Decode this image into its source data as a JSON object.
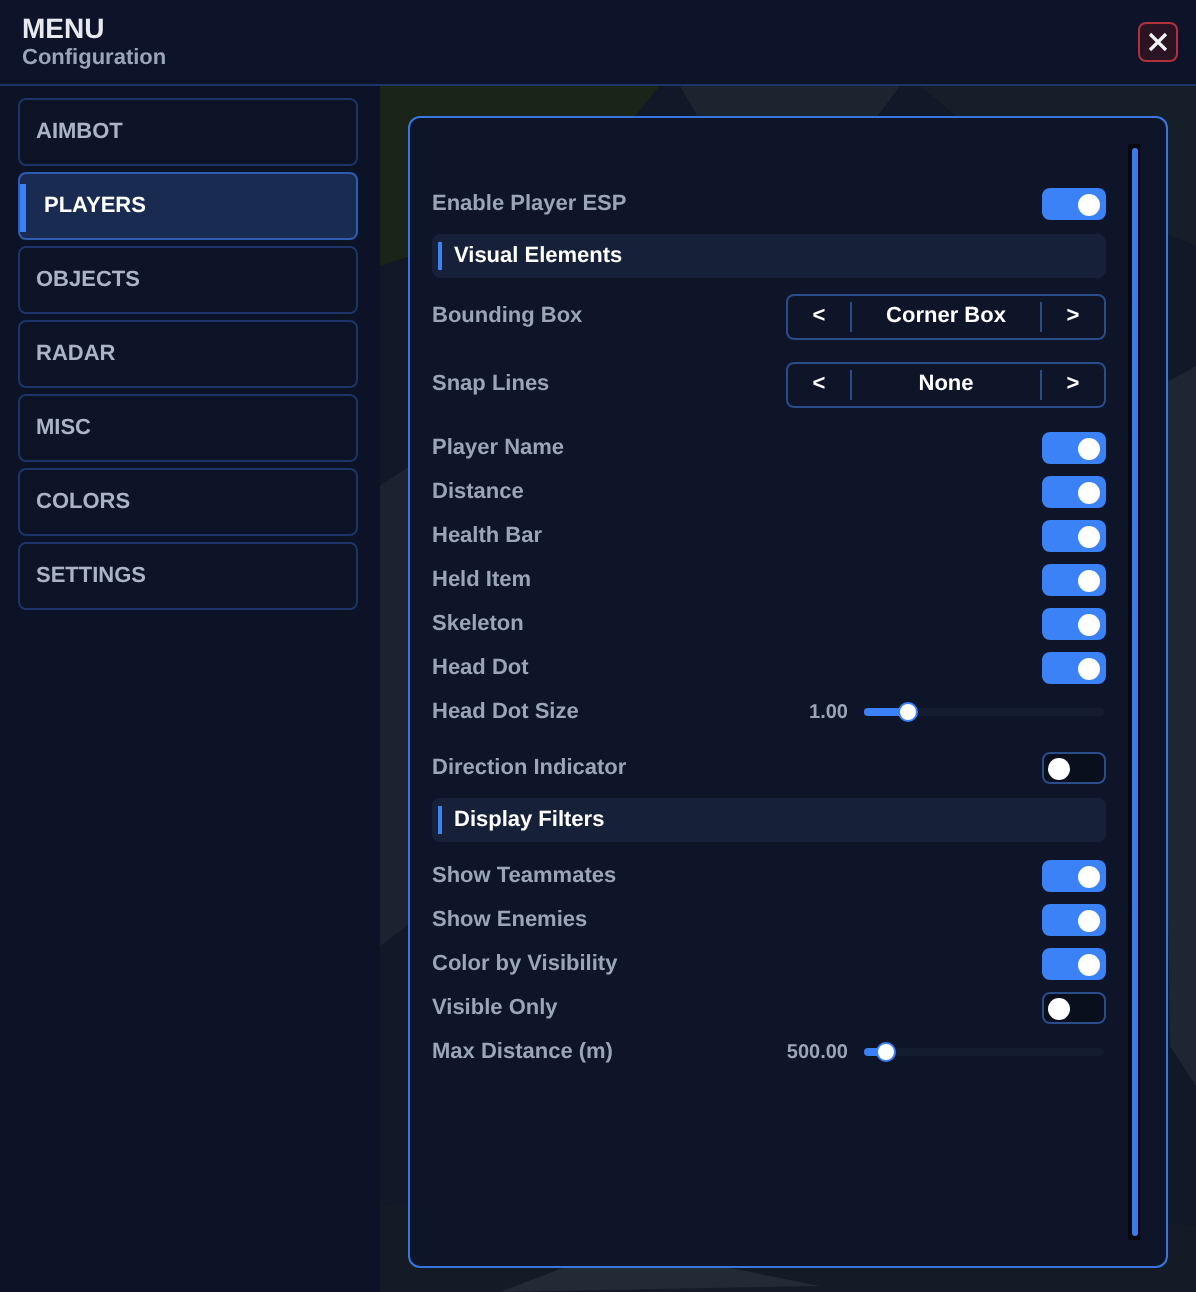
{
  "window": {
    "title": "MENU",
    "subtitle": "Configuration"
  },
  "sidebar": {
    "items": [
      {
        "label": "AIMBOT",
        "selected": false
      },
      {
        "label": "PLAYERS",
        "selected": true
      },
      {
        "label": "OBJECTS",
        "selected": false
      },
      {
        "label": "RADAR",
        "selected": false
      },
      {
        "label": "MISC",
        "selected": false
      },
      {
        "label": "COLORS",
        "selected": false
      },
      {
        "label": "SETTINGS",
        "selected": false
      }
    ]
  },
  "settings": [
    {
      "kind": "toggle",
      "label": "Enable Player ESP",
      "on": true
    },
    {
      "kind": "section",
      "label": "Visual Elements"
    },
    {
      "kind": "selector",
      "label": "Bounding Box",
      "prev": "<",
      "value": "Corner Box",
      "next": ">"
    },
    {
      "kind": "selector",
      "label": "Snap Lines",
      "prev": "<",
      "value": "None",
      "next": ">"
    },
    {
      "kind": "toggle",
      "label": "Player Name",
      "on": true
    },
    {
      "kind": "toggle",
      "label": "Distance",
      "on": true
    },
    {
      "kind": "toggle",
      "label": "Health Bar",
      "on": true
    },
    {
      "kind": "toggle",
      "label": "Held Item",
      "on": true
    },
    {
      "kind": "toggle",
      "label": "Skeleton",
      "on": true
    },
    {
      "kind": "toggle",
      "label": "Head Dot",
      "on": true
    },
    {
      "kind": "slider",
      "label": "Head Dot Size",
      "reading": "1.00",
      "level": 0.18
    },
    {
      "kind": "toggle",
      "label": "Direction Indicator",
      "on": false
    },
    {
      "kind": "section",
      "label": "Display Filters"
    },
    {
      "kind": "toggle",
      "label": "Show Teammates",
      "on": true
    },
    {
      "kind": "toggle",
      "label": "Show Enemies",
      "on": true
    },
    {
      "kind": "toggle",
      "label": "Color by Visibility",
      "on": true
    },
    {
      "kind": "toggle",
      "label": "Visible Only",
      "on": false
    },
    {
      "kind": "slider",
      "label": "Max Distance (m)",
      "reading": "500.00",
      "level": 0.09
    }
  ]
}
